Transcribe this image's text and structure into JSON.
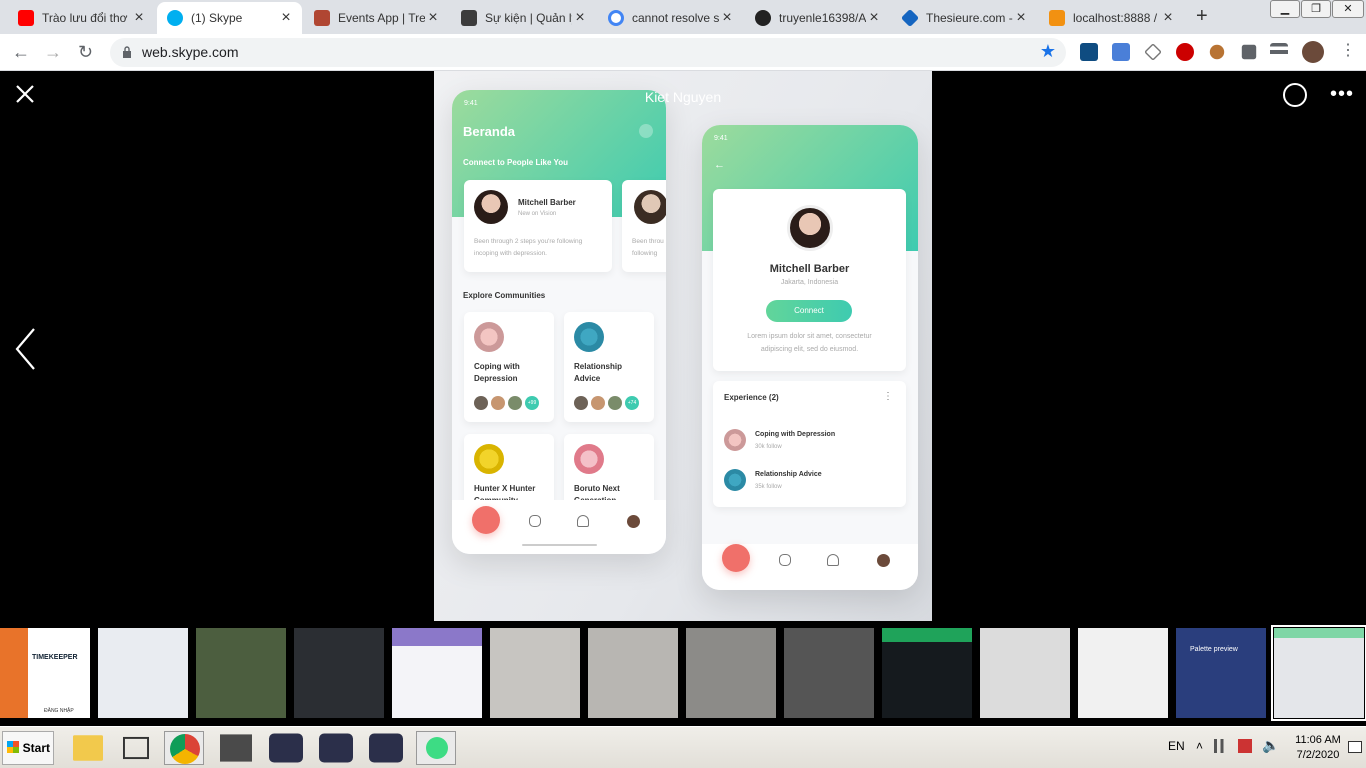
{
  "browser": {
    "tabs": [
      {
        "title": "Trào lưu đổi thơ",
        "icon": "youtube-icon",
        "color": "#ff0000",
        "active": false
      },
      {
        "title": "(1) Skype",
        "icon": "skype-icon",
        "color": "#00aff0",
        "active": true
      },
      {
        "title": "Events App | Tre",
        "icon": "trello-icon",
        "color": "#b04632",
        "active": false
      },
      {
        "title": "Sự kiện | Quản lý",
        "icon": "doc-icon",
        "color": "#3c3c3c",
        "active": false
      },
      {
        "title": "cannot resolve sy",
        "icon": "google-icon",
        "color": "#4285f4",
        "active": false
      },
      {
        "title": "truyenle16398/A",
        "icon": "github-icon",
        "color": "#222222",
        "active": false
      },
      {
        "title": "Thesieure.com -",
        "icon": "thesieure-icon",
        "color": "#1565c0",
        "active": false
      },
      {
        "title": "localhost:8888 /",
        "icon": "phpmyadmin-icon",
        "color": "#f29111",
        "active": false
      }
    ],
    "new_tab": "+",
    "window_controls": [
      "minimize-icon",
      "restore-icon",
      "close-icon"
    ],
    "url": "web.skype.com",
    "extensions": [
      "jsonviewer-icon",
      "translate-icon",
      "eyedropper-icon",
      "adblock-icon",
      "extension-icon",
      "puzzle-icon",
      "media-icon",
      "profile-avatar"
    ]
  },
  "viewer": {
    "caller_name": "Kiet Nguyen",
    "left_phone": {
      "time": "9:41",
      "title": "Beranda",
      "connect_heading": "Connect to People Like You",
      "person": {
        "name": "Mitchell Barber",
        "subtitle": "New on Vision",
        "desc": "Been through 2 steps you're following incoping with depression.",
        "desc2": "Been throu following"
      },
      "explore_heading": "Explore Communities",
      "communities": [
        {
          "name1": "Coping with",
          "name2": "Depression",
          "badge": "+99"
        },
        {
          "name1": "Relationship",
          "name2": "Advice",
          "badge": "+74"
        },
        {
          "name1": "Hunter X Hunter",
          "name2": "Community",
          "badge": ""
        },
        {
          "name1": "Boruto Next",
          "name2": "Generation",
          "badge": ""
        }
      ]
    },
    "right_phone": {
      "time": "9:41",
      "back": "←",
      "name": "Mitchell Barber",
      "location": "Jakarta, Indonesia",
      "connect_label": "Connect",
      "about": "Lorem ipsum dolor sit amet, consectetur",
      "about2": "adipiscing elit, sed do eiusmod.",
      "experience_title": "Experience (2)",
      "experiences": [
        {
          "name": "Coping with Depression",
          "follow": "30k follow"
        },
        {
          "name": "Relationship Advice",
          "follow": "35k follow"
        }
      ]
    }
  },
  "thumbs": [
    {
      "label": "TIMEKEEPER",
      "sub": "ĐĂNG NHẬP"
    },
    {
      "label": ""
    },
    {
      "label": ""
    },
    {
      "label": ""
    },
    {
      "label": ""
    },
    {
      "label": ""
    },
    {
      "label": ""
    },
    {
      "label": ""
    },
    {
      "label": ""
    },
    {
      "label": ""
    },
    {
      "label": ""
    },
    {
      "label": ""
    },
    {
      "label": "Palette preview"
    },
    {
      "label": ""
    }
  ],
  "taskbar": {
    "start": "Start",
    "lang": "EN",
    "time": "11:06 AM",
    "date": "7/2/2020"
  }
}
